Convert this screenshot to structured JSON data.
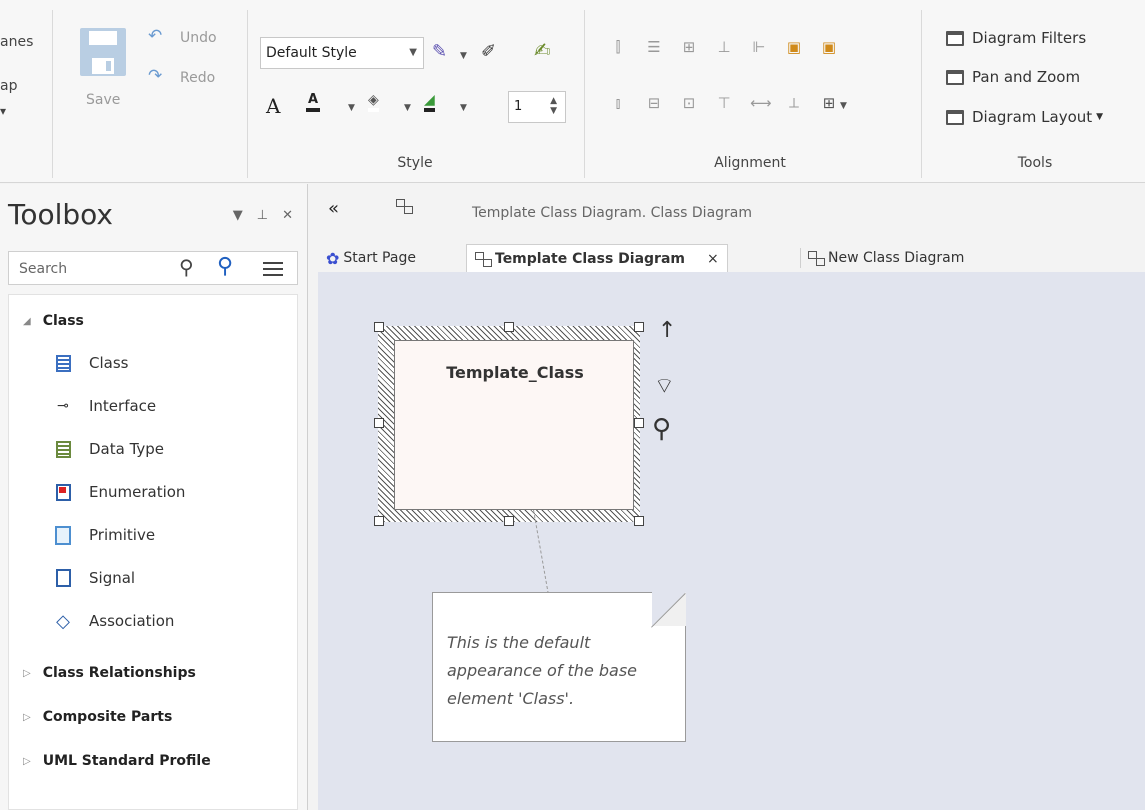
{
  "ribbon": {
    "panes_fragment": "anes",
    "map_fragment": "ap",
    "dropdown_fragment": "▾",
    "save_label": "Save",
    "undo_label": "Undo",
    "redo_label": "Redo",
    "style": {
      "combo_value": "Default Style",
      "line_width_value": "1",
      "group_label": "Style"
    },
    "alignment": {
      "group_label": "Alignment"
    },
    "tools": {
      "diagram_filters_label": "Diagram Filters",
      "pan_zoom_label": "Pan and Zoom",
      "diagram_layout_label": "Diagram Layout",
      "group_label": "Tools"
    }
  },
  "toolbox": {
    "title": "Toolbox",
    "search_placeholder": "Search",
    "categories": [
      {
        "label": "Class",
        "expanded": true
      },
      {
        "label": "Class Relationships",
        "expanded": false
      },
      {
        "label": "Composite Parts",
        "expanded": false
      },
      {
        "label": "UML Standard Profile",
        "expanded": false
      }
    ],
    "class_items": [
      {
        "label": "Class",
        "icon": "class-icon"
      },
      {
        "label": "Interface",
        "icon": "interface-icon"
      },
      {
        "label": "Data Type",
        "icon": "data-type-icon"
      },
      {
        "label": "Enumeration",
        "icon": "enumeration-icon"
      },
      {
        "label": "Primitive",
        "icon": "primitive-icon"
      },
      {
        "label": "Signal",
        "icon": "signal-icon"
      },
      {
        "label": "Association",
        "icon": "association-icon"
      }
    ]
  },
  "document": {
    "caption": "Template Class Diagram.  Class Diagram",
    "tabs": [
      {
        "label": "Start Page",
        "active": false
      },
      {
        "label": "Template Class Diagram",
        "active": true,
        "closable": true
      },
      {
        "label": "New Class Diagram",
        "active": false
      }
    ],
    "close_glyph": "×"
  },
  "diagram": {
    "element_name": "Template_Class",
    "note_text": "This is the default appearance of the base element 'Class'.",
    "colors": {
      "canvas": "#e1e4ee",
      "element_fill": "#fdf7f5"
    }
  }
}
